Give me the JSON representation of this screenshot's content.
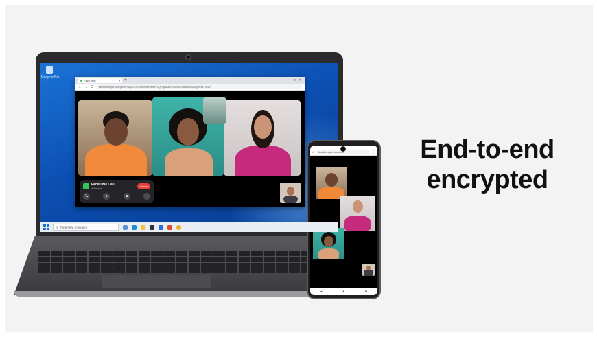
{
  "headline": {
    "line1": "End-to-end",
    "line2": "encrypted"
  },
  "laptop": {
    "desktop": {
      "recycle_bin_label": "Recycle Bin"
    },
    "browser": {
      "tab_title": "FaceTime",
      "tab_close": "●",
      "tab_new": "+",
      "url": "facetime.apple.com/join#v=1&p=ZHOMHecwEeyWBFIGQy7gNA&k=rDoKvMJVBMhlsRoAbgsxHdGTRZP",
      "nav_back": "←",
      "nav_forward": "→",
      "nav_reload": "C",
      "window_controls": [
        "–",
        "□",
        "✕"
      ]
    },
    "facetime_panel": {
      "title": "FaceTime Call",
      "subtitle": "4 People",
      "leave_label": "Leave",
      "controls": [
        {
          "name": "effects",
          "glyph": "⤡"
        },
        {
          "name": "mic",
          "glyph": "●"
        },
        {
          "name": "camera",
          "glyph": "■"
        },
        {
          "name": "more",
          "glyph": "⋯"
        }
      ]
    },
    "taskbar": {
      "search_placeholder": "Type here to search"
    }
  },
  "phone": {
    "url": "facetime.apple.com/join",
    "nav": [
      "◂",
      "●",
      "■"
    ]
  },
  "colors": {
    "accent_green": "#34c759",
    "leave_red": "#e5413a",
    "desktop_blue": "#0c4fb2"
  }
}
